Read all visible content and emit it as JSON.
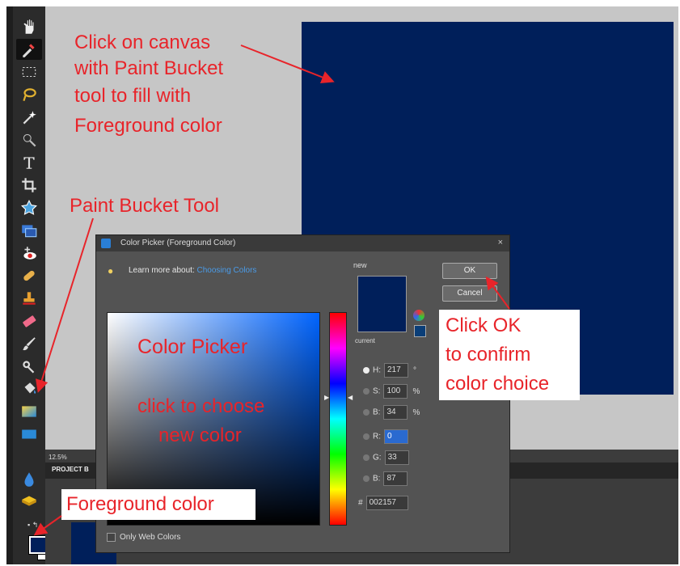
{
  "dialog": {
    "title": "Color Picker (Foreground Color)",
    "learn_prefix": "Learn more about:",
    "learn_link": "Choosing Colors",
    "new_label": "new",
    "current_label": "current",
    "ok_label": "OK",
    "cancel_label": "Cancel",
    "only_web_colors": "Only Web Colors",
    "fields": [
      {
        "label": "H:",
        "value": "217",
        "unit": "°",
        "selected": true
      },
      {
        "label": "S:",
        "value": "100",
        "unit": "%",
        "selected": false
      },
      {
        "label": "B:",
        "value": "34",
        "unit": "%",
        "selected": false
      },
      {
        "label": "R:",
        "value": "0",
        "unit": "",
        "selected": false
      },
      {
        "label": "G:",
        "value": "33",
        "unit": "",
        "selected": false
      },
      {
        "label": "B:",
        "value": "87",
        "unit": "",
        "selected": false
      }
    ],
    "hex_label": "#",
    "hex_value": "002157",
    "new_color": "#001f5a"
  },
  "status": {
    "zoom": "12.5%",
    "project_bin": "PROJECT B"
  },
  "annotations": {
    "canvas_note_1": "Click on canvas",
    "canvas_note_2": "with Paint Bucket",
    "canvas_note_3": "tool to fill with",
    "canvas_note_4": "Foreground color",
    "paint_bucket": "Paint Bucket Tool",
    "color_picker": "Color Picker",
    "choose_1": "click to choose",
    "choose_2": "new color",
    "ok_1": "Click OK",
    "ok_2": "to confirm",
    "ok_3": "color choice",
    "foreground": "Foreground color"
  },
  "colors": {
    "foreground": "#001f5a",
    "annotation": "#e8242a"
  },
  "tools": [
    "hand-tool",
    "eyedropper-tool",
    "marquee-tool",
    "lasso-tool",
    "magic-wand-tool",
    "quick-selection-tool",
    "type-tool",
    "crop-tool",
    "cookie-cutter-tool",
    "recompose-tool",
    "red-eye-tool",
    "healing-brush-tool",
    "clone-stamp-tool",
    "eraser-tool",
    "brush-tool",
    "smart-brush-tool",
    "paint-bucket-tool",
    "gradient-tool",
    "shape-tool",
    "blur-tool",
    "sponge-tool"
  ]
}
